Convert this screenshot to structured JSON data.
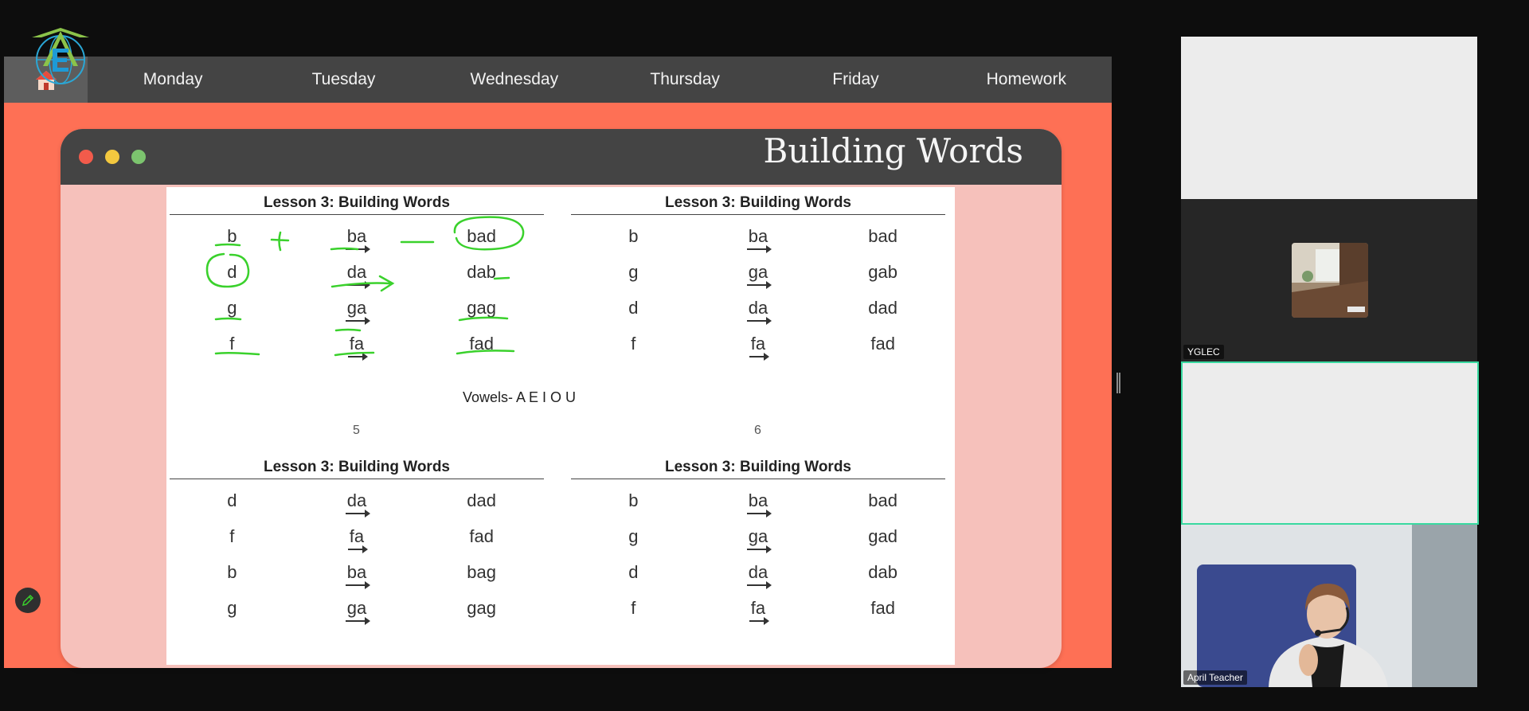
{
  "nav": {
    "home_icon": "home-icon",
    "items": [
      "Monday",
      "Tuesday",
      "Wednesday",
      "Thursday",
      "Friday",
      "Homework"
    ]
  },
  "slide": {
    "title": "Building Words",
    "lessons": [
      {
        "title": "Lesson 3: Building Words",
        "rows": [
          [
            "b",
            "ba",
            "bad"
          ],
          [
            "d",
            "da",
            "dab"
          ],
          [
            "g",
            "ga",
            "gag"
          ],
          [
            "f",
            "fa",
            "fad"
          ]
        ]
      },
      {
        "title": "Lesson 3: Building Words",
        "rows": [
          [
            "b",
            "ba",
            "bad"
          ],
          [
            "g",
            "ga",
            "gab"
          ],
          [
            "d",
            "da",
            "dad"
          ],
          [
            "f",
            "fa",
            "fad"
          ]
        ]
      },
      {
        "title": "Lesson 3: Building Words",
        "rows": [
          [
            "d",
            "da",
            "dad"
          ],
          [
            "f",
            "fa",
            "fad"
          ],
          [
            "b",
            "ba",
            "bag"
          ],
          [
            "g",
            "ga",
            "gag"
          ]
        ]
      },
      {
        "title": "Lesson 3: Building Words",
        "rows": [
          [
            "b",
            "ba",
            "bad"
          ],
          [
            "g",
            "ga",
            "gad"
          ],
          [
            "d",
            "da",
            "dab"
          ],
          [
            "f",
            "fa",
            "fad"
          ]
        ]
      }
    ],
    "vowels": "Vowels- A E I O U",
    "page_left": "5",
    "page_right": "6"
  },
  "participants": [
    {
      "name": ""
    },
    {
      "name": "YGLEC"
    },
    {
      "name": ""
    },
    {
      "name": "April Teacher"
    }
  ],
  "colors": {
    "accent": "#fe7055",
    "nav_bg": "#444444",
    "annotation": "#3ad12c",
    "speaker_border": "#39d9a0"
  }
}
